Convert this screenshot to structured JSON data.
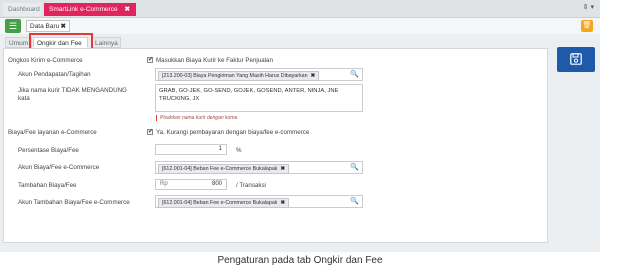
{
  "topbar": {
    "tabs": [
      {
        "label": "Dashboard"
      },
      {
        "label": "SmartLink e-Commerce",
        "close": "✖"
      }
    ],
    "right_label": "⇕ ▾"
  },
  "toolbar": {
    "menu_glyph": "☰",
    "doc_tab_label": "Data Baru",
    "doc_tab_close": "✖",
    "trash_glyph": "🗑"
  },
  "tabs": [
    {
      "label": "Umum"
    },
    {
      "label": "Ongkir dan Fee"
    },
    {
      "label": "Lainnya"
    }
  ],
  "form": {
    "ongkos_label": "Ongkos Kirim e-Commerce",
    "ongkos_checkbox_label": "Masukkan Biaya Kurir ke Faktur Penjualan",
    "akun_pendapatan_label": "Akun Pendapatan/Tagihan",
    "akun_pendapatan_value": "[213.200-03] Biaya Pengiriman Yang Masih Harus Dibayarkan",
    "kurir_label_line1": "Jika nama kurir TIDAK MENGANDUNG",
    "kurir_label_line2": "kata",
    "kurir_value": "GRAB, GO-JEK, GO-SEND, GOJEK, GOSEND, ANTER, NINJA, JNE TRUCKING, JX",
    "kurir_hint": "Pisahkan nama kurir dengan koma",
    "fee_label": "Biaya/Fee layanan e-Commerce",
    "fee_checkbox_label": "Ya, Kurangi pembayaran dengan biaya/fee e-commerce",
    "persentase_label": "Persentase Biaya/Fee",
    "persentase_value": "1",
    "persentase_unit": "%",
    "akun_fee_label": "Akun Biaya/Fee e-Commerce",
    "akun_fee_value": "[612.001-04] Beban Fee e-Commerce Bukalapak",
    "tambahan_label": "Tambahan Biaya/Fee",
    "tambahan_prefix": "Rp",
    "tambahan_value": "800",
    "tambahan_unit": "/ Transaksi",
    "akun_tambahan_label": "Akun Tambahan Biaya/Fee e-Commerce",
    "akun_tambahan_value": "[612.001-04] Beban Fee e-Commerce Bukalapak",
    "chip_remove": "✖",
    "search_glyph": "🔍",
    "check_glyph": "✔"
  },
  "caption": "Pengaturan pada tab Ongkir dan Fee",
  "colors": {
    "accent_pink": "#e0245e",
    "save_blue": "#1e5aa8",
    "menu_green": "#43a047",
    "trash_orange": "#f5a623",
    "highlight_red": "#e53935"
  }
}
